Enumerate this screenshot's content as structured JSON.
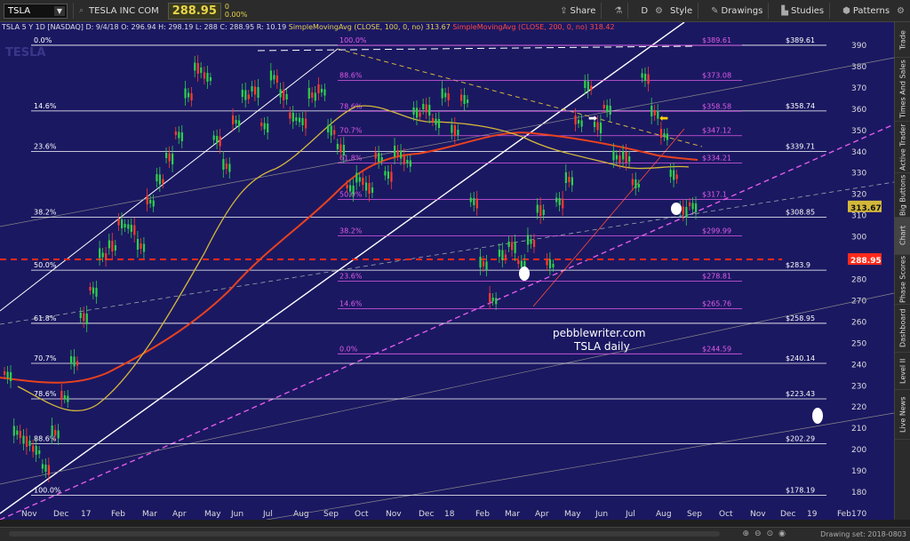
{
  "toolbar": {
    "symbol": "TSLA",
    "company": "TESLA INC COM",
    "last_price": "288.95",
    "change_abs": "0",
    "change_pct": "0.00%",
    "share": "Share",
    "d_label": "D",
    "style": "Style",
    "drawings": "Drawings",
    "studies": "Studies",
    "patterns": "Patterns"
  },
  "header": {
    "symbol_period": "TSLA 5 Y 1D [NASDAQ]",
    "ohlc": "D: 9/4/18  O: 296.94  H: 298.19  L: 288  C: 288.95  R: 10.19",
    "sma100": "SimpleMovingAvg (CLOSE, 100, 0, no)  313.67",
    "sma200": "SimpleMovingAvg (CLOSE, 200, 0, no)  318.42"
  },
  "watermark": "TESLA",
  "annotation": {
    "line1": "pebblewriter.com",
    "line2": "TSLA daily"
  },
  "y_axis": [
    "390",
    "380",
    "370",
    "360",
    "350",
    "340",
    "330",
    "320",
    "310",
    "300",
    "290",
    "280",
    "270",
    "260",
    "250",
    "240",
    "230",
    "220",
    "210",
    "200",
    "190",
    "180",
    "170"
  ],
  "x_axis": [
    "Nov",
    "Dec",
    "17",
    "Feb",
    "Mar",
    "Apr",
    "May",
    "Jun",
    "Jul",
    "Aug",
    "Sep",
    "Oct",
    "Nov",
    "Dec",
    "18",
    "Feb",
    "Mar",
    "Apr",
    "May",
    "Jun",
    "Jul",
    "Aug",
    "Sep",
    "Oct",
    "Nov",
    "Dec",
    "19",
    "Feb"
  ],
  "fib_left": [
    {
      "pct": "0.0%",
      "price": "$389.61"
    },
    {
      "pct": "14.6%",
      "price": "$358.74"
    },
    {
      "pct": "23.6%",
      "price": "$339.71"
    },
    {
      "pct": "38.2%",
      "price": "$308.85"
    },
    {
      "pct": "50.0%",
      "price": "$283.9"
    },
    {
      "pct": "61.8%",
      "price": "$258.95"
    },
    {
      "pct": "70.7%",
      "price": "$240.14"
    },
    {
      "pct": "78.6%",
      "price": "$223.43"
    },
    {
      "pct": "88.6%",
      "price": "$202.29"
    },
    {
      "pct": "100.0%",
      "price": "$178.19"
    }
  ],
  "fib_right": [
    {
      "pct": "100.0%",
      "price": "$389.61"
    },
    {
      "pct": "88.6%",
      "price": "$373.08"
    },
    {
      "pct": "78.6%",
      "price": "$358.58"
    },
    {
      "pct": "70.7%",
      "price": "$347.12"
    },
    {
      "pct": "61.8%",
      "price": "$334.21"
    },
    {
      "pct": "50.0%",
      "price": "$317.1"
    },
    {
      "pct": "38.2%",
      "price": "$299.99"
    },
    {
      "pct": "23.6%",
      "price": "$278.81"
    },
    {
      "pct": "14.6%",
      "price": "$265.76"
    },
    {
      "pct": "0.0%",
      "price": "$244.59"
    }
  ],
  "price_tags": {
    "last": "288.95",
    "sma": "313.67"
  },
  "right_tabs": [
    "Trade",
    "Times And Sales",
    "Active Trader",
    "Big Buttons",
    "Chart",
    "Phase Scores",
    "Dashboard",
    "Level II",
    "Live News"
  ],
  "status": {
    "drawing_set": "Drawing set: 2018-0803"
  },
  "colors": {
    "bg": "#1b1862",
    "sma100": "#d4b83a",
    "sma200": "#e8421e",
    "fib": "#e05ce6",
    "price_line": "#ff2a1a"
  }
}
